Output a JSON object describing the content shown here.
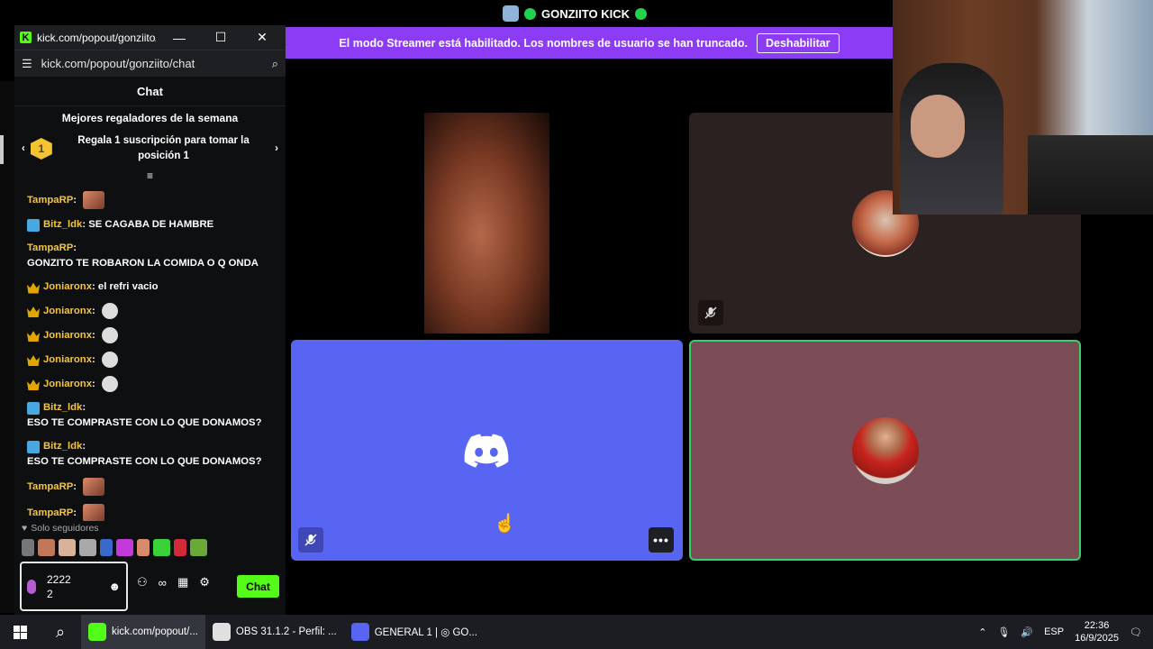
{
  "top_bar": {
    "title": "GONZIITO KICK"
  },
  "banner": {
    "message": "El modo Streamer está habilitado. Los nombres de usuario se han truncado.",
    "button_label": "Deshabilitar"
  },
  "chat_window": {
    "window_title": "kick.com/popout/gonziito/c...",
    "url": "kick.com/popout/gonziito/chat",
    "heading": "Chat",
    "gifters_heading": "Mejores regaladores de la semana",
    "gifters_rank": "1",
    "gifters_text": "Regala 1 suscripción para tomar la posición 1",
    "messages": [
      {
        "user": "TampaRP",
        "text": "",
        "badge": "none",
        "emote": "face"
      },
      {
        "user": "Bitz_ldk",
        "text": "SE CAGABA DE HAMBRE",
        "badge": "hammer",
        "emote": ""
      },
      {
        "user": "TampaRP",
        "text": "GONZITO TE ROBARON LA COMIDA O Q ONDA",
        "badge": "none",
        "emote": ""
      },
      {
        "user": "Joniaronx",
        "text": "el refri vacio",
        "badge": "crown",
        "emote": ""
      },
      {
        "user": "Joniaronx",
        "text": "",
        "badge": "crown",
        "emote": "skull"
      },
      {
        "user": "Joniaronx",
        "text": "",
        "badge": "crown",
        "emote": "skull"
      },
      {
        "user": "Joniaronx",
        "text": "",
        "badge": "crown",
        "emote": "skull"
      },
      {
        "user": "Joniaronx",
        "text": "",
        "badge": "crown",
        "emote": "skull"
      },
      {
        "user": "Bitz_ldk",
        "text": "ESO TE COMPRASTE CON LO QUE DONAMOS?",
        "badge": "hammer",
        "emote": ""
      },
      {
        "user": "Bitz_ldk",
        "text": "ESO TE COMPRASTE CON LO QUE DONAMOS?",
        "badge": "hammer",
        "emote": ""
      },
      {
        "user": "TampaRP",
        "text": "",
        "badge": "none",
        "emote": "face"
      },
      {
        "user": "TampaRP",
        "text": "",
        "badge": "none",
        "emote": "face"
      }
    ],
    "followers_only": "Solo seguidores",
    "input_value_line1": "2222",
    "input_value_line2": "2",
    "send_label": "Chat"
  },
  "taskbar": {
    "apps": [
      {
        "label": "kick.com/popout/...",
        "icon": "kick-icon",
        "color": "#53fc18",
        "active": true
      },
      {
        "label": "OBS 31.1.2 - Perfil: ...",
        "icon": "obs-icon",
        "color": "#e0e0e0",
        "active": false
      },
      {
        "label": "GENERAL 1 | ◎ GO...",
        "icon": "discord-icon",
        "color": "#5865f2",
        "active": false
      }
    ],
    "language": "ESP",
    "time": "22:36",
    "date": "16/9/2025"
  }
}
